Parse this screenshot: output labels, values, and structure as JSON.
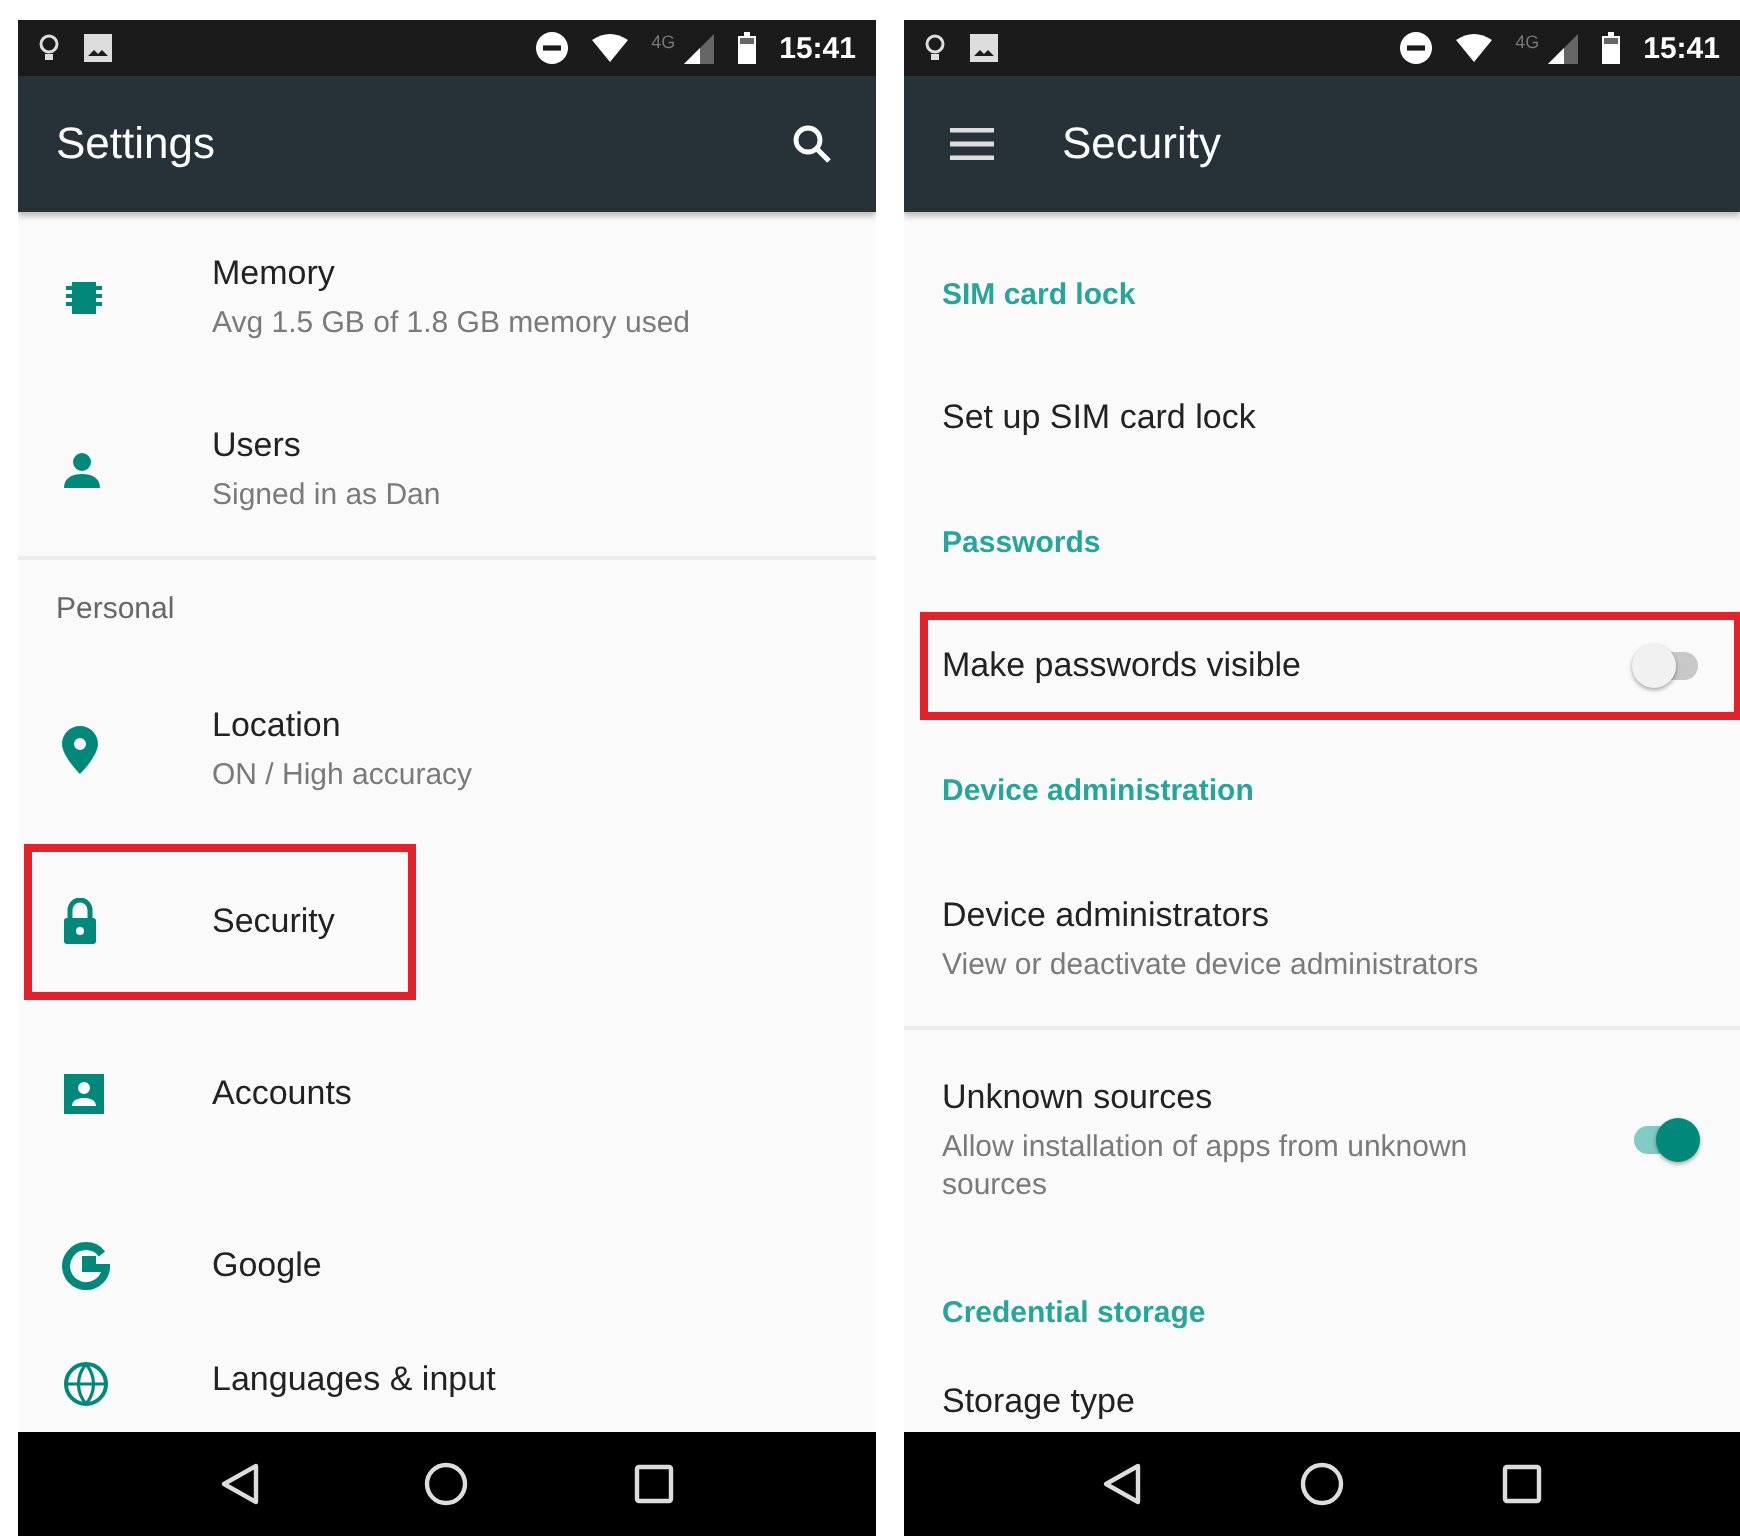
{
  "screens": [
    {
      "status_bar": {
        "network": "4G",
        "time": "15:41"
      },
      "toolbar": {
        "title": "Settings",
        "menu_button": false,
        "search_button": true
      },
      "icons": true,
      "items": [
        {
          "kind": "setting",
          "title": "Memory",
          "subtitle": "Avg 1.5 GB of 1.8 GB memory used",
          "highlighted": false
        },
        {
          "kind": "setting",
          "title": "Users",
          "subtitle": "Signed in as Dan",
          "highlighted": false
        },
        {
          "kind": "divider"
        },
        {
          "kind": "header",
          "title": "Personal"
        },
        {
          "kind": "setting",
          "title": "Location",
          "subtitle": "ON / High accuracy",
          "highlighted": false
        },
        {
          "kind": "setting",
          "title": "Security",
          "highlighted": true
        },
        {
          "kind": "setting",
          "title": "Accounts",
          "highlighted": false
        },
        {
          "kind": "setting",
          "title": "Google",
          "highlighted": false
        },
        {
          "kind": "setting",
          "title": "Languages & input",
          "highlighted": false
        }
      ]
    },
    {
      "status_bar": {
        "network": "4G",
        "time": "15:41"
      },
      "toolbar": {
        "title": "Security",
        "menu_button": true,
        "search_button": false
      },
      "icons": false,
      "items": [
        {
          "kind": "header",
          "title": "SIM card lock"
        },
        {
          "kind": "setting",
          "title": "Set up SIM card lock",
          "highlighted": false
        },
        {
          "kind": "header",
          "title": "Passwords"
        },
        {
          "kind": "switch",
          "title": "Make passwords visible",
          "on": false,
          "highlighted": true
        },
        {
          "kind": "header",
          "title": "Device administration"
        },
        {
          "kind": "setting",
          "title": "Device administrators",
          "subtitle": "View or deactivate device administrators",
          "highlighted": false
        },
        {
          "kind": "divider"
        },
        {
          "kind": "switch",
          "title": "Unknown sources",
          "subtitle": "Allow installation of apps from unknown sources",
          "on": true,
          "highlighted": false
        },
        {
          "kind": "header",
          "title": "Credential storage"
        },
        {
          "kind": "setting",
          "title": "Storage type",
          "highlighted": false
        }
      ]
    }
  ]
}
